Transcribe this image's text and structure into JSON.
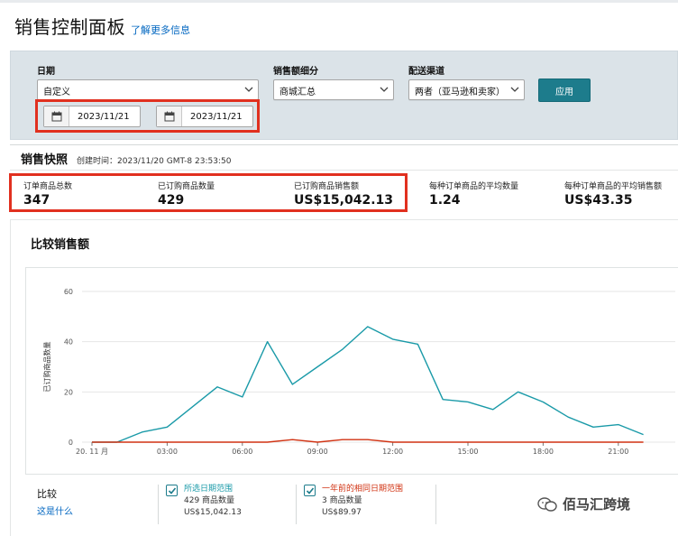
{
  "header": {
    "title": "销售控制面板",
    "learn_more": "了解更多信息"
  },
  "filters": {
    "date_label": "日期",
    "date_value": "自定义",
    "start_date": "2023/11/21",
    "end_date": "2023/11/21",
    "breakdown_label": "销售额细分",
    "breakdown_value": "商城汇总",
    "channel_label": "配送渠道",
    "channel_value": "两者（亚马逊和卖家）",
    "apply_label": "应用"
  },
  "snapshot": {
    "title": "销售快照",
    "timestamp": "创建时间：2023/11/20 GMT-8 23:53:50",
    "metrics": [
      {
        "label": "订单商品总数",
        "value": "347"
      },
      {
        "label": "已订购商品数量",
        "value": "429"
      },
      {
        "label": "已订购商品销售额",
        "value": "US$15,042.13"
      },
      {
        "label": "每种订单商品的平均数量",
        "value": "1.24"
      },
      {
        "label": "每种订单商品的平均销售额",
        "value": "US$43.35"
      }
    ]
  },
  "compare": {
    "title": "比较销售额",
    "legend_compare": "比较",
    "legend_what": "这是什么",
    "legend_current_title": "所选日期范围",
    "legend_current_units": "429 商品数量",
    "legend_current_sales": "US$15,042.13",
    "legend_prior_title": "一年前的相同日期范围",
    "legend_prior_units": "3 商品数量",
    "legend_prior_sales": "US$89.97"
  },
  "colors": {
    "current_series": "#1a9aa8",
    "prior_series": "#d13212",
    "apply_button": "#1d7c8c",
    "highlight_box": "#e1301f"
  },
  "watermark": "佰马汇跨境",
  "chart_data": {
    "type": "line",
    "ylabel": "已订购商品数量",
    "xlabel": "",
    "ylim": [
      0,
      60
    ],
    "yticks": [
      "0",
      "20",
      "40",
      "60"
    ],
    "x_tick_labels": [
      "20. 11 月",
      "03:00",
      "06:00",
      "09:00",
      "12:00",
      "15:00",
      "18:00",
      "21:00"
    ],
    "x_tick_hours": [
      0,
      3,
      6,
      9,
      12,
      15,
      18,
      21
    ],
    "x": [
      0,
      1,
      2,
      3,
      4,
      5,
      6,
      7,
      8,
      9,
      10,
      11,
      12,
      13,
      14,
      15,
      16,
      17,
      18,
      19,
      20,
      21,
      22
    ],
    "series": [
      {
        "name": "所选日期范围",
        "values": [
          0,
          0,
          4,
          6,
          14,
          22,
          18,
          40,
          23,
          30,
          37,
          46,
          41,
          39,
          17,
          16,
          13,
          20,
          16,
          10,
          6,
          7,
          3
        ]
      },
      {
        "name": "一年前的相同日期范围",
        "values": [
          0,
          0,
          0,
          0,
          0,
          0,
          0,
          0,
          1,
          0,
          1,
          1,
          0,
          0,
          0,
          0,
          0,
          0,
          0,
          0,
          0,
          0,
          0
        ]
      }
    ]
  }
}
